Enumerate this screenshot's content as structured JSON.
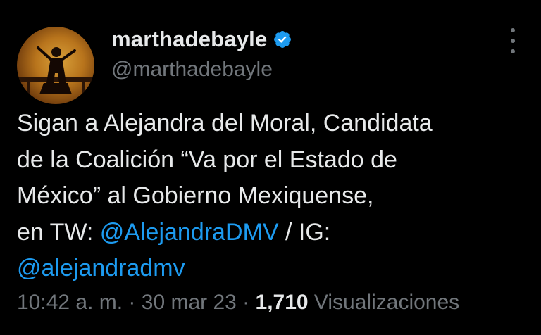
{
  "author": {
    "display_name": "marthadebayle",
    "handle": "@marthadebayle",
    "verified": true,
    "verified_color": "#1d9bf0",
    "avatar_icon": "profile-photo"
  },
  "tweet": {
    "line1": "Sigan a Alejandra del Moral, Candidata",
    "line2": "de la Coalición “Va por el Estado de",
    "line3": "México” al Gobierno Mexiquense,",
    "line4_prefix": "en TW: ",
    "mention_tw": "@AlejandraDMV",
    "line4_suffix": " / IG:",
    "mention_ig": "@alejandradmv",
    "mention_color": "#1d9bf0"
  },
  "meta": {
    "time": "10:42 a. m.",
    "separator": " · ",
    "date": "30 mar 23",
    "view_count": "1,710",
    "views_label": " Visualizaciones"
  },
  "icons": {
    "more": "more-options-icon",
    "verified": "verified-badge-icon"
  }
}
